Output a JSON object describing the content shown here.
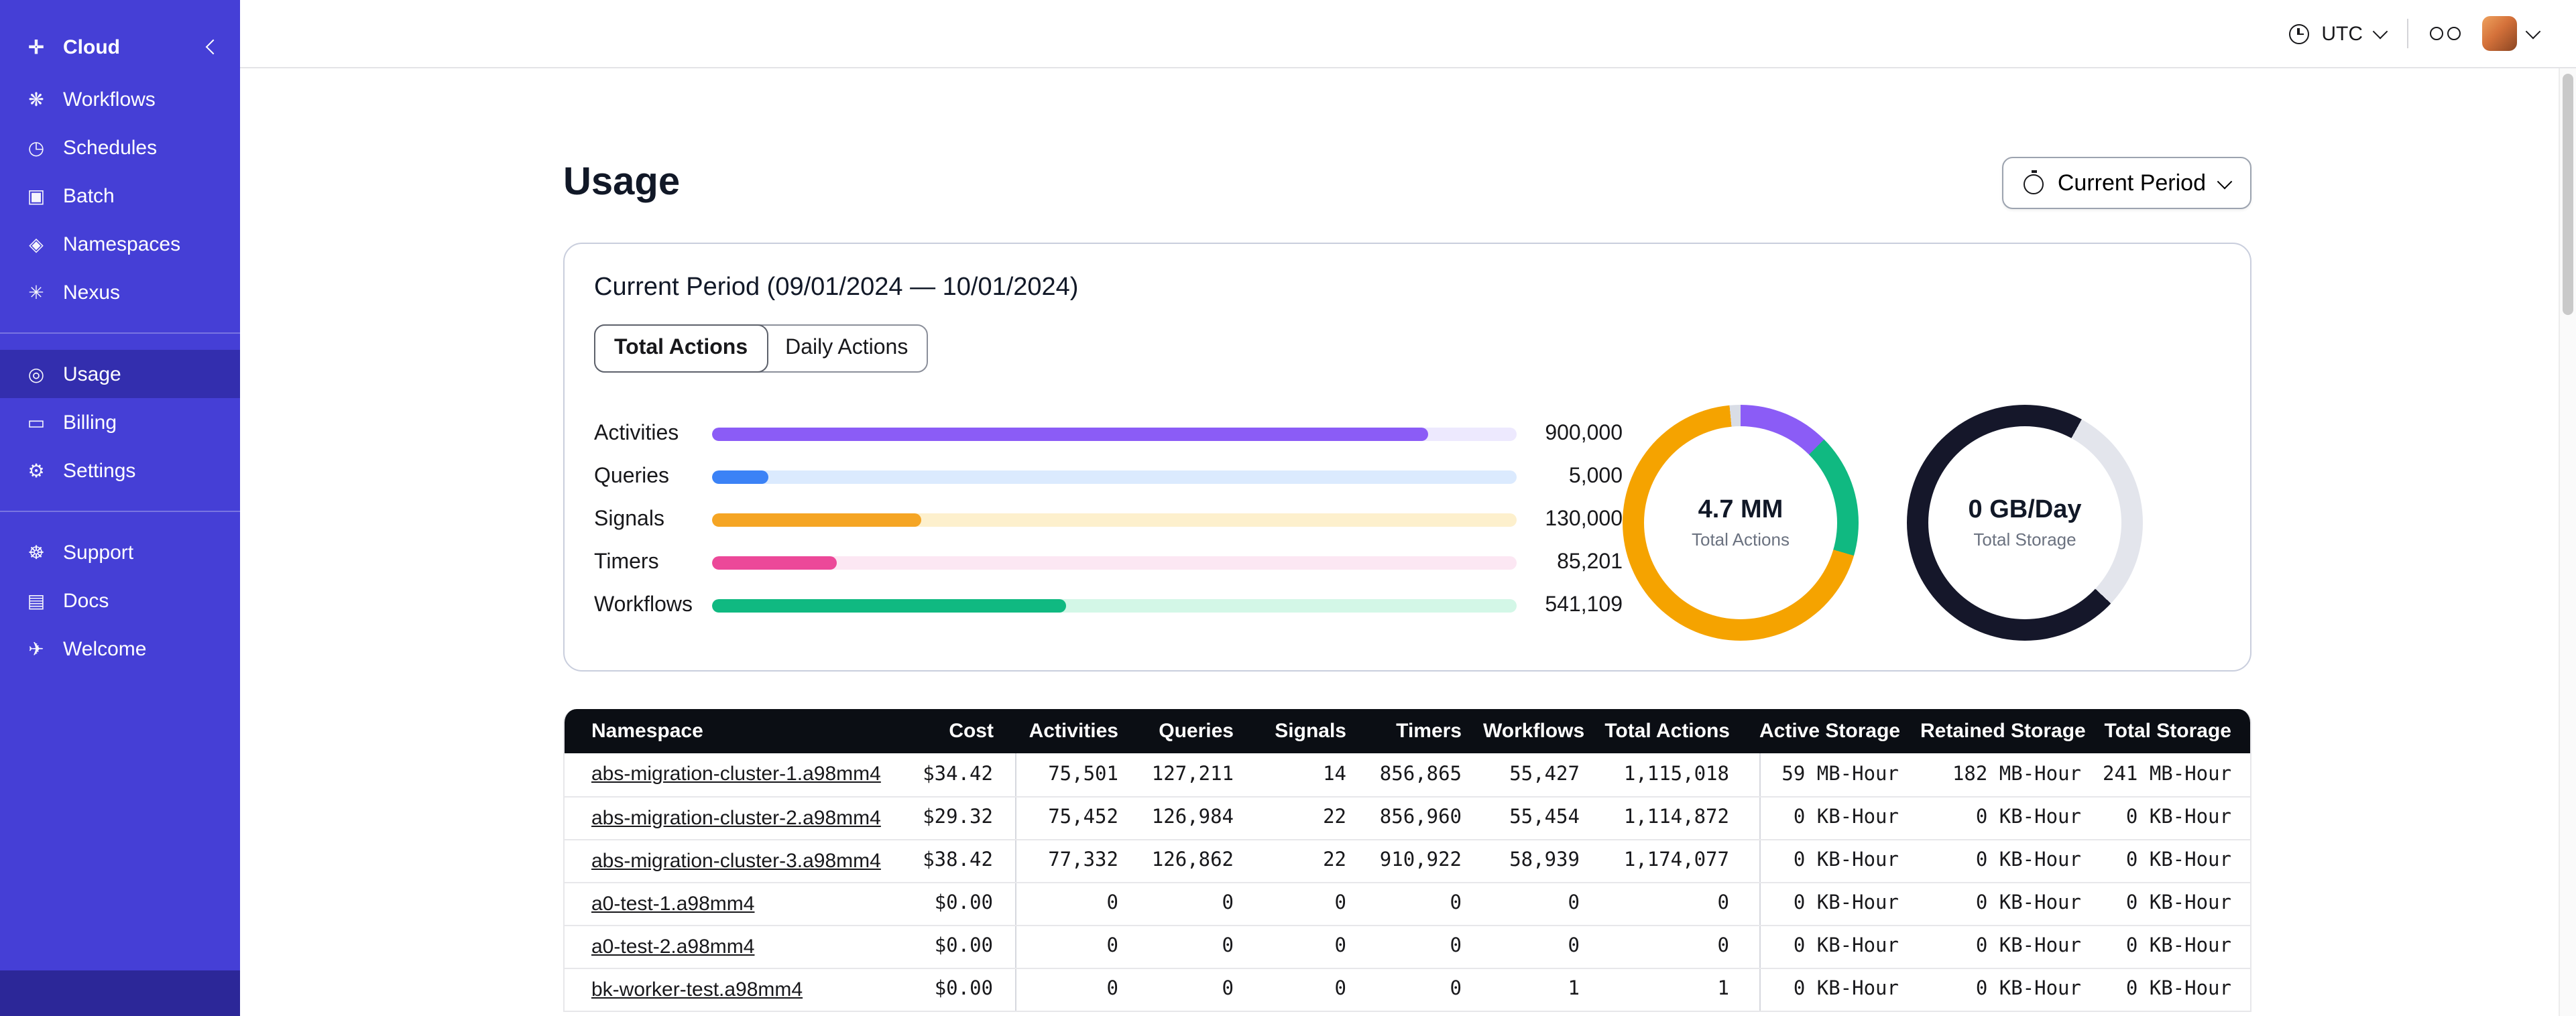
{
  "sidebar": {
    "header": {
      "label": "Cloud",
      "icon": "temporal-logo-icon",
      "glyph": "✛"
    },
    "nav_main": [
      {
        "label": "Workflows",
        "icon": "workflows-icon",
        "glyph": "❋"
      },
      {
        "label": "Schedules",
        "icon": "schedules-icon",
        "glyph": "◷"
      },
      {
        "label": "Batch",
        "icon": "batch-icon",
        "glyph": "▣"
      },
      {
        "label": "Namespaces",
        "icon": "namespaces-icon",
        "glyph": "◈"
      },
      {
        "label": "Nexus",
        "icon": "nexus-icon",
        "glyph": "✳"
      }
    ],
    "nav_account": [
      {
        "label": "Usage",
        "icon": "usage-icon",
        "glyph": "◎",
        "active": true
      },
      {
        "label": "Billing",
        "icon": "billing-icon",
        "glyph": "▭"
      },
      {
        "label": "Settings",
        "icon": "settings-icon",
        "glyph": "⚙"
      }
    ],
    "nav_help": [
      {
        "label": "Support",
        "icon": "support-icon",
        "glyph": "☸"
      },
      {
        "label": "Docs",
        "icon": "docs-icon",
        "glyph": "▤"
      },
      {
        "label": "Welcome",
        "icon": "welcome-icon",
        "glyph": "✈"
      }
    ],
    "colors": {
      "background": "#453fd6",
      "active_item": "#332eae",
      "footer": "#2c2798"
    }
  },
  "topbar": {
    "timezone": "UTC"
  },
  "page": {
    "title": "Usage",
    "period_button": "Current Period"
  },
  "usage_card": {
    "title": "Current Period (09/01/2024 — 10/01/2024)",
    "tabs": [
      {
        "label": "Total Actions",
        "active": true
      },
      {
        "label": "Daily Actions",
        "active": false
      }
    ],
    "bars": [
      {
        "label": "Activities",
        "value": "900,000",
        "percent": "89%",
        "color": "#8b5cf6",
        "track": "#ede9fe"
      },
      {
        "label": "Queries",
        "value": "5,000",
        "percent": "7%",
        "color": "#3b82f6",
        "track": "#dbeafe"
      },
      {
        "label": "Signals",
        "value": "130,000",
        "percent": "26%",
        "color": "#f5a524",
        "track": "#fdf0cd"
      },
      {
        "label": "Timers",
        "value": "85,201",
        "percent": "15.5%",
        "color": "#ec4899",
        "track": "#fce7f3"
      },
      {
        "label": "Workflows",
        "value": "541,109",
        "percent": "44%",
        "color": "#10b981",
        "track": "#d3f7e7"
      }
    ],
    "donuts": [
      {
        "value": "4.7 MM",
        "label": "Total Actions",
        "segments": [
          {
            "color": "#8b5cf6",
            "percent": 12.5
          },
          {
            "color": "#10b981",
            "percent": 17
          },
          {
            "color": "#f5a300",
            "percent": 69
          },
          {
            "color": "#d9dde6",
            "percent": 1.5
          }
        ]
      },
      {
        "value": "0 GB/Day",
        "label": "Total Storage",
        "segments": [
          {
            "color": "#15172a",
            "percent": 8
          },
          {
            "color": "#e3e5ec",
            "percent": 29
          },
          {
            "color": "#15172a",
            "percent": 63
          }
        ]
      }
    ]
  },
  "table": {
    "columns": [
      "Namespace",
      "Cost",
      "Activities",
      "Queries",
      "Signals",
      "Timers",
      "Workflows",
      "Total Actions",
      "Active Storage",
      "Retained Storage",
      "Total Storage"
    ],
    "rows": [
      {
        "namespace": "abs-migration-cluster-1.a98mm4",
        "cost": "$34.42",
        "activities": "75,501",
        "queries": "127,211",
        "signals": "14",
        "timers": "856,865",
        "workflows": "55,427",
        "total_actions": "1,115,018",
        "active_storage": "59 MB-Hour",
        "retained_storage": "182 MB-Hour",
        "total_storage": "241 MB-Hour"
      },
      {
        "namespace": "abs-migration-cluster-2.a98mm4",
        "cost": "$29.32",
        "activities": "75,452",
        "queries": "126,984",
        "signals": "22",
        "timers": "856,960",
        "workflows": "55,454",
        "total_actions": "1,114,872",
        "active_storage": "0 KB-Hour",
        "retained_storage": "0 KB-Hour",
        "total_storage": "0 KB-Hour"
      },
      {
        "namespace": "abs-migration-cluster-3.a98mm4",
        "cost": "$38.42",
        "activities": "77,332",
        "queries": "126,862",
        "signals": "22",
        "timers": "910,922",
        "workflows": "58,939",
        "total_actions": "1,174,077",
        "active_storage": "0 KB-Hour",
        "retained_storage": "0 KB-Hour",
        "total_storage": "0 KB-Hour"
      },
      {
        "namespace": "a0-test-1.a98mm4",
        "cost": "$0.00",
        "activities": "0",
        "queries": "0",
        "signals": "0",
        "timers": "0",
        "workflows": "0",
        "total_actions": "0",
        "active_storage": "0 KB-Hour",
        "retained_storage": "0 KB-Hour",
        "total_storage": "0 KB-Hour"
      },
      {
        "namespace": "a0-test-2.a98mm4",
        "cost": "$0.00",
        "activities": "0",
        "queries": "0",
        "signals": "0",
        "timers": "0",
        "workflows": "0",
        "total_actions": "0",
        "active_storage": "0 KB-Hour",
        "retained_storage": "0 KB-Hour",
        "total_storage": "0 KB-Hour"
      },
      {
        "namespace": "bk-worker-test.a98mm4",
        "cost": "$0.00",
        "activities": "0",
        "queries": "0",
        "signals": "0",
        "timers": "0",
        "workflows": "1",
        "total_actions": "1",
        "active_storage": "0 KB-Hour",
        "retained_storage": "0 KB-Hour",
        "total_storage": "0 KB-Hour"
      }
    ]
  }
}
